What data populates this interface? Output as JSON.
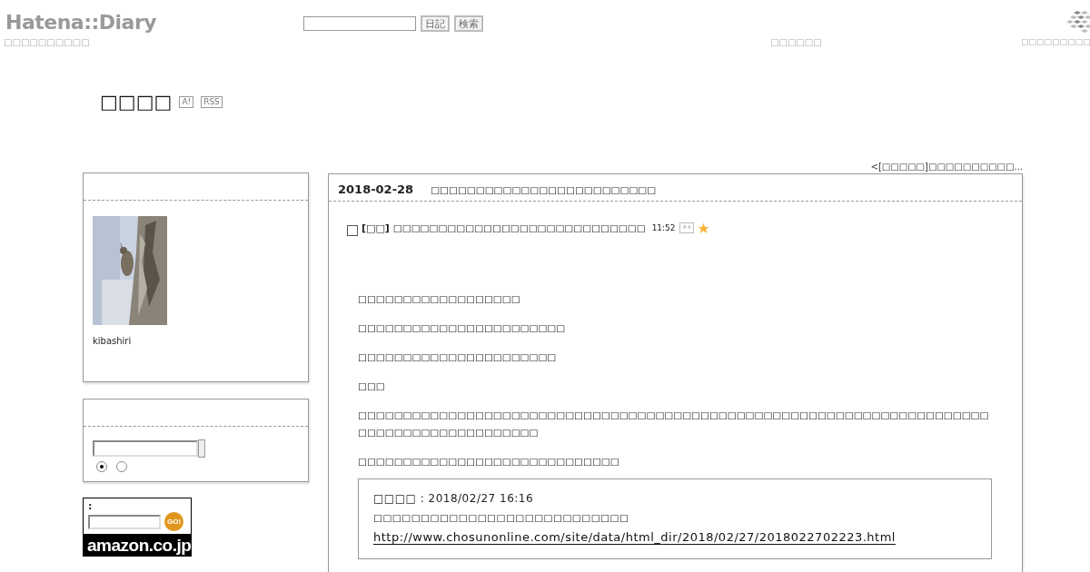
{
  "header": {
    "logo": "Hatena::Diary",
    "subtitle": "□□□□□□□□□□",
    "search": {
      "buttons": [
        "日記",
        "検索"
      ]
    },
    "center_link": "□□□□□□",
    "right_link": "□□□□□□□□□"
  },
  "blog": {
    "title": "□□□□",
    "badges": [
      "A!",
      "RSS"
    ]
  },
  "nav_link": "<[□□□□□]□□□□□□□□□□...",
  "sidebar": {
    "profile": {
      "name": "kibashiri"
    },
    "search": {
      "radios": [
        {
          "selected": true
        },
        {
          "selected": false
        }
      ]
    },
    "amazon": {
      "label": ":",
      "button": "GO!",
      "logo": "amazon.co.jp"
    }
  },
  "entry": {
    "date": "2018-02-28",
    "title": "□□□□□□□□□□□□□□□□□□□□□□□□□",
    "section": {
      "category": "[□□]",
      "heading": "□□□□□□□□□□□□□□□□□□□□□□□□□□□□",
      "time": "11:52"
    },
    "paragraphs": [
      "□□□□□□□□□□□□□□□□□□",
      "□□□□□□□□□□□□□□□□□□□□□□□",
      "□□□□□□□□□□□□□□□□□□□□□□",
      "□□□",
      "□□□□□□□□□□□□□□□□□□□□□□□□□□□□□□□□□□□□□□□□□□□□□□□□□□□□□□□□□□□□□□□□□□□□□□□□□□□□□□□□□□□□□□□□□□",
      "□□□□□□□□□□□□□□□□□□□□□□□□□□□□□"
    ],
    "quote": {
      "source": "□□□□ : 2018/02/27 16:16",
      "text": "□□□□□□□□□□□□□□□□□□□□□□□□□□□",
      "link": "http://www.chosunonline.com/site/data/html_dir/2018/02/27/2018022702223.html"
    }
  }
}
